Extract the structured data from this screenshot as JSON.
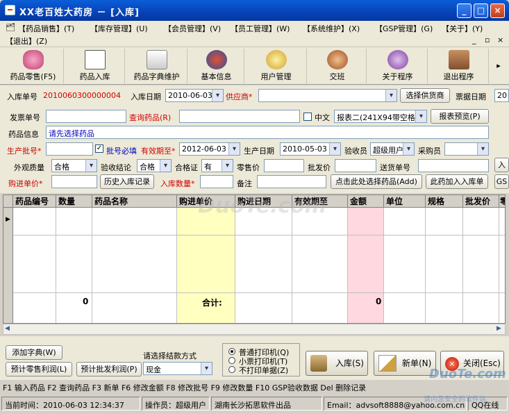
{
  "window": {
    "title": "XX老百姓大药房 － [入库]",
    "min": "_",
    "max": "□",
    "close": "×"
  },
  "menu": {
    "items": [
      "【药品销售】(T)",
      "【库存管理】(U)",
      "【会员管理】(V)",
      "【员工管理】(W)",
      "【系统维护】(X)",
      "【GSP管理】(G)",
      "【关于】(Y)",
      "【退出】(Z)"
    ],
    "mdi": [
      "_",
      "▫",
      "×"
    ]
  },
  "toolbar": {
    "items": [
      "药品零售(F5)",
      "药品入库",
      "药品字典维护",
      "基本信息",
      "用户管理",
      "交班",
      "关于程序",
      "退出程序"
    ],
    "more": "▸"
  },
  "form": {
    "order_no_label": "入库单号",
    "order_no": "2010060300000004",
    "date_label": "入库日期",
    "date": "2010-06-03",
    "supplier_label": "供应商*",
    "supplier": "",
    "choose_supplier": "选择供货商",
    "bill_date_label": "票据日期",
    "bill_date": "20",
    "invoice_label": "发票单号",
    "invoice": "",
    "query_label": "查询药品(R)",
    "query": "",
    "chinese_label": "中文",
    "report_sel": "报表二(241X94带空格",
    "preview": "报表预览(P)",
    "drug_info_label": "药品信息",
    "drug_info": "请先选择药品",
    "batch_label": "生产批号*",
    "batch": "",
    "batch_required_label": "批号必填",
    "batch_required_mark": "✓",
    "expiry_label": "有效期至*",
    "expiry": "2012-06-03",
    "prod_date_label": "生产日期",
    "prod_date": "2010-05-03",
    "checker_label": "验收员",
    "checker": "超级用户",
    "buyer_label": "采购员",
    "buyer": "",
    "appearance_label": "外观质量",
    "appearance": "合格",
    "accept_label": "验收结论",
    "accept": "合格",
    "cert_label": "合格证",
    "cert": "有",
    "retail_label": "零售价",
    "retail": "",
    "wholesale_label": "批发价",
    "wholesale": "",
    "delivery_label": "送货单号",
    "delivery": "",
    "edge_btn1": "入",
    "edge_btn2": "GS",
    "price_label": "购进单价*",
    "price": "",
    "history_btn": "历史入库记录",
    "qty_label": "入库数量*",
    "qty": "",
    "remark_label": "备注",
    "remark": "",
    "pick_btn": "点击此处选择药品(Add)",
    "add_btn": "此药加入入库单"
  },
  "grid": {
    "columns": [
      "药品编号",
      "数量",
      "药品名称",
      "购进单价",
      "购进日期",
      "有效期至",
      "金额",
      "单位",
      "规格",
      "批发价",
      "零"
    ],
    "total_qty": "0",
    "total_label": "合计:",
    "total_amount": "0",
    "row_marker": "▶"
  },
  "bottom": {
    "add_dict": "添加字典(W)",
    "retail_profit": "预计零售利润(L)",
    "wholesale_profit": "预计批发利润(P)",
    "pay_label": "请选择结款方式",
    "pay": "现金",
    "print_opts": [
      "普通打印机(Q)",
      "小票打印机(T)",
      "不打印单据(Z)"
    ],
    "stock_in": "入库(S)",
    "new_bill": "新单(N)",
    "close": "关闭(Esc)"
  },
  "fkeys": "F1 输入药品  F2 查询药品  F3 新单   F6 修改金额  F8 修改批号  F9 修改数量  F10 GSP验收数据   Del 删除记录",
  "status": {
    "time": "当前时间：2010-06-03 12:34:37",
    "operator": "操作员：超级用户",
    "company": "湖南长沙拓思软件出品",
    "email": "Email：advsoft8888@yahoo.com.cn",
    "qq": "QQ在线"
  },
  "watermark": {
    "grid": "DuoTe.com",
    "corner": "DuoTe.com",
    "corner_sub": "请内急安全的软件站"
  },
  "colors": {
    "title_bar": "#0742b6",
    "price_col": "#ffffc0",
    "amount_col": "#ffd8e0",
    "label_red": "#d00000",
    "label_blue": "#0000c0"
  }
}
